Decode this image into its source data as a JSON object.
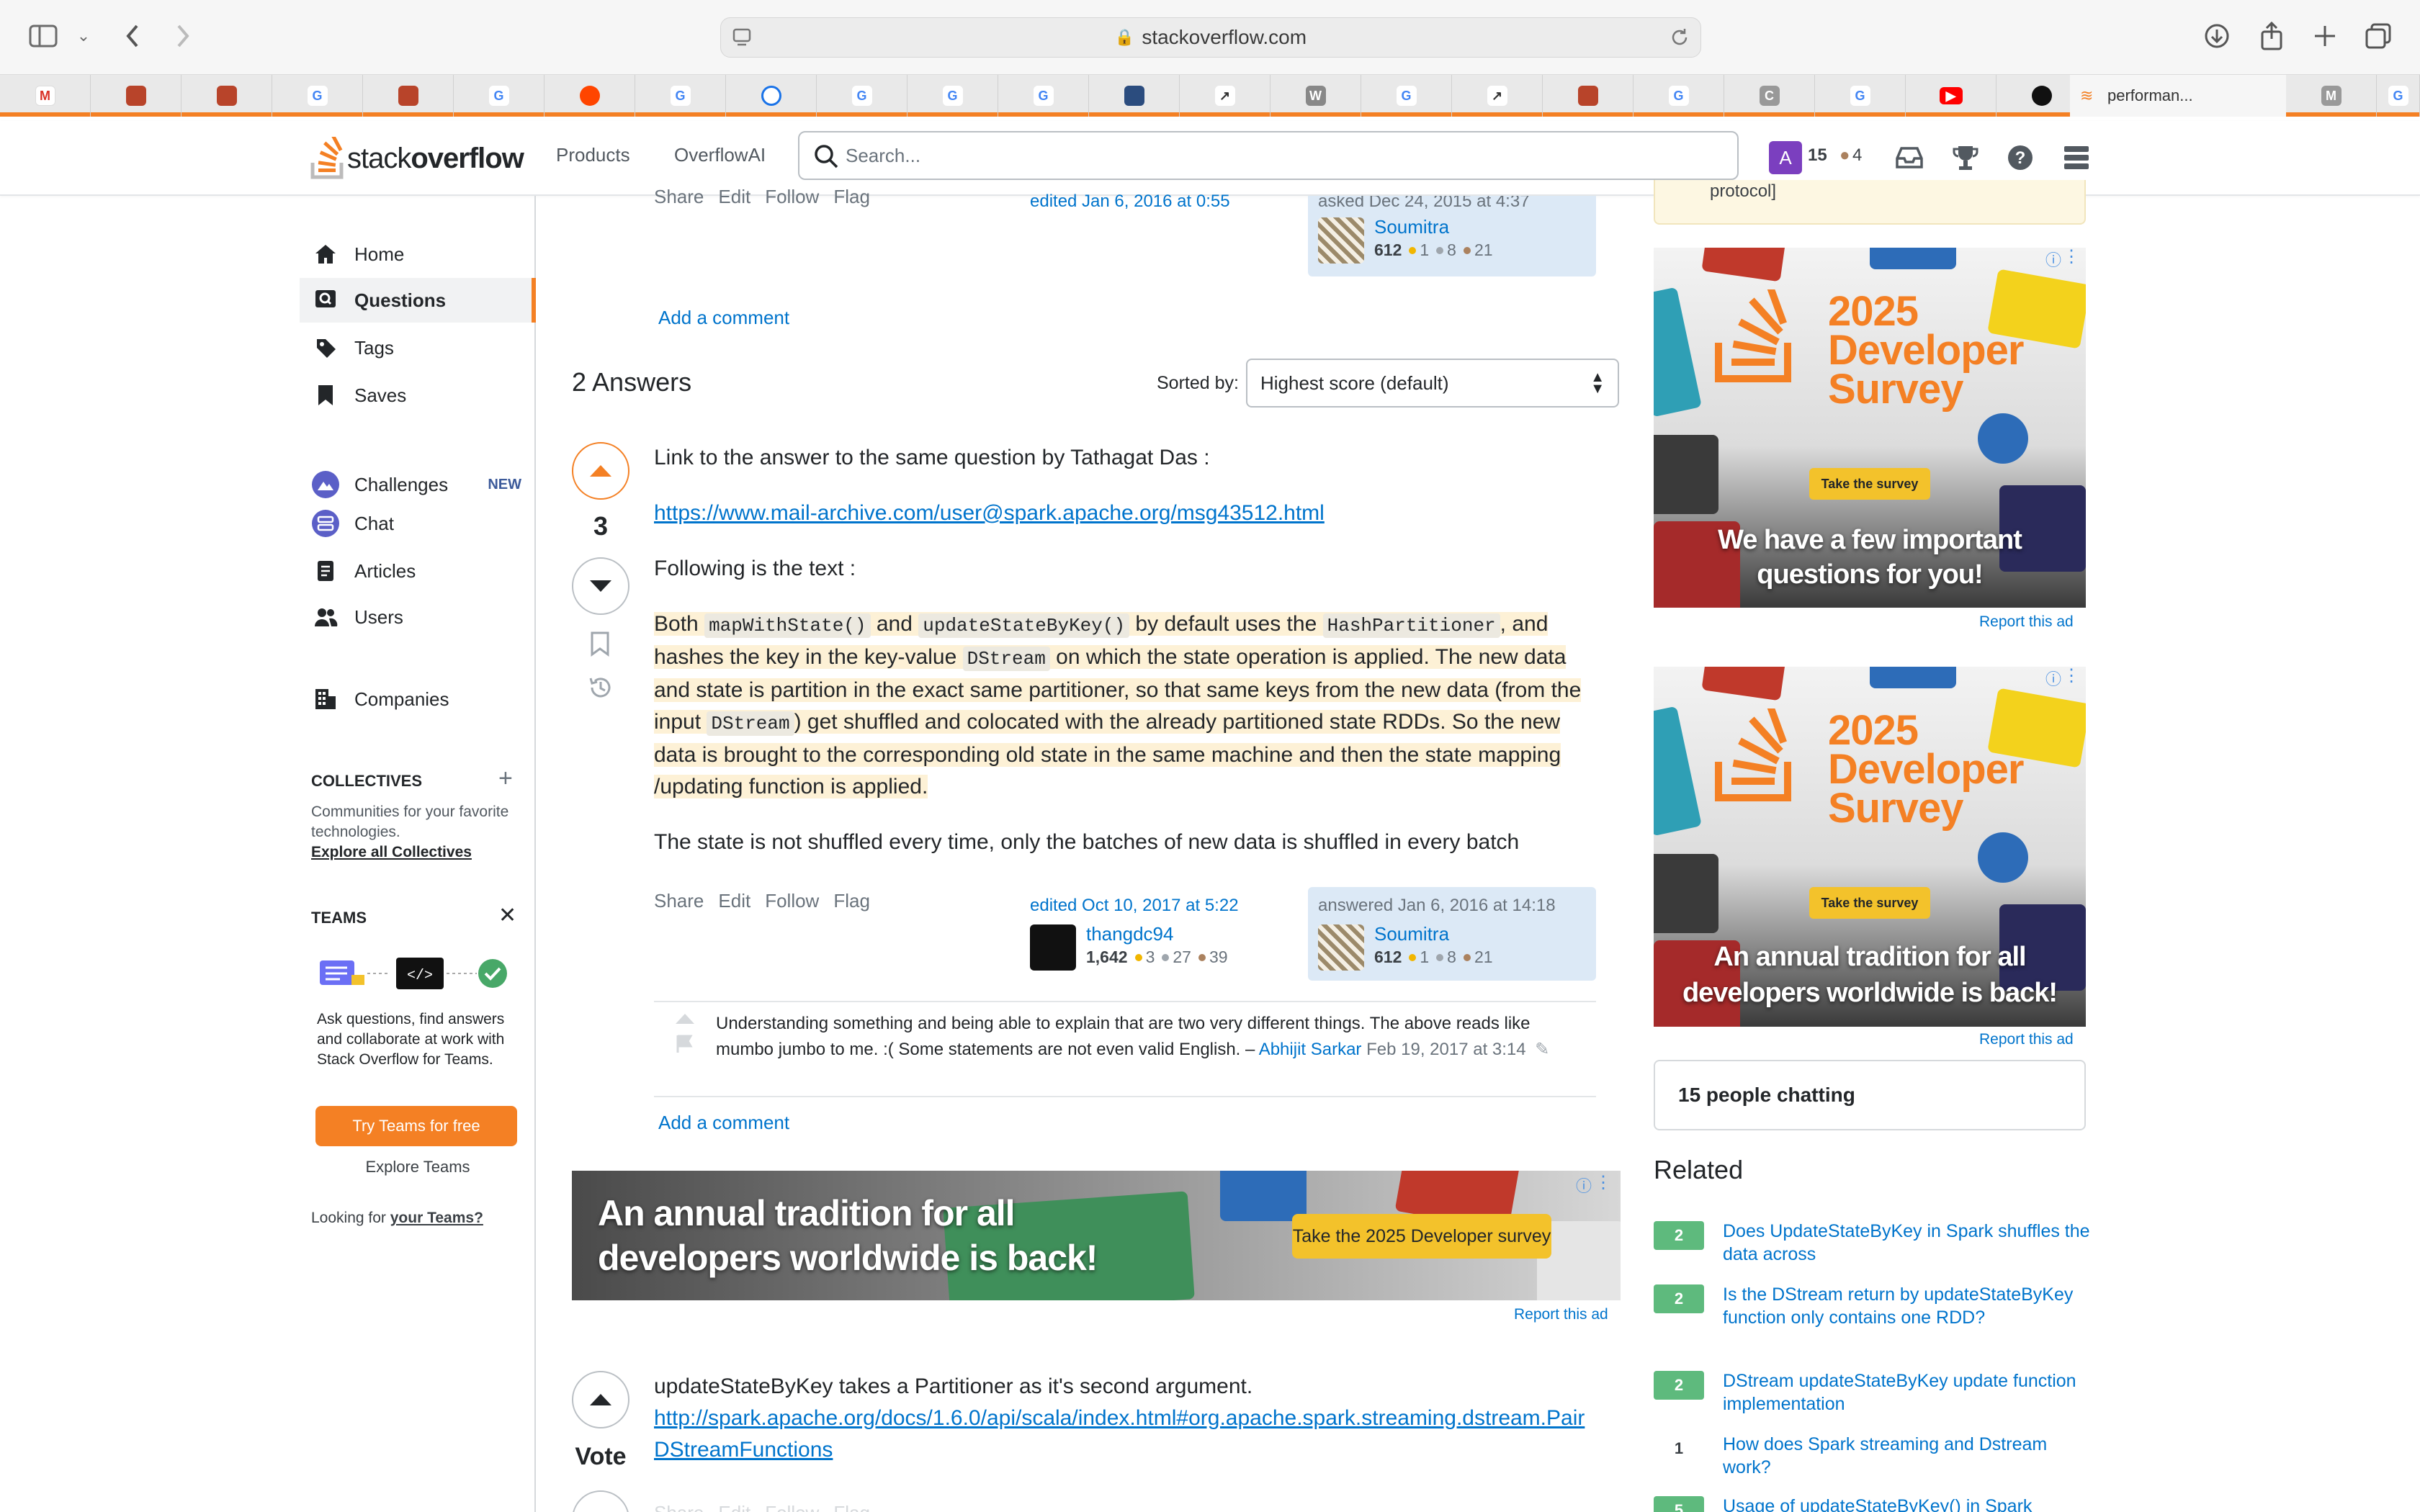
{
  "browser": {
    "url": "stackoverflow.com",
    "active_tab_label": "performan..."
  },
  "header": {
    "logo_light": "stack",
    "logo_bold": "overflow",
    "nav_products": "Products",
    "nav_overflowai": "OverflowAI",
    "search_placeholder": "Search...",
    "avatar_letter": "A",
    "reputation": "15",
    "bronze_count": "4"
  },
  "sidebar": {
    "items": [
      {
        "label": "Home"
      },
      {
        "label": "Questions"
      },
      {
        "label": "Tags"
      },
      {
        "label": "Saves"
      },
      {
        "label": "Challenges",
        "badge": "NEW"
      },
      {
        "label": "Chat"
      },
      {
        "label": "Articles"
      },
      {
        "label": "Users"
      },
      {
        "label": "Companies"
      }
    ],
    "collectives_title": "COLLECTIVES",
    "collectives_desc": "Communities for your favorite technologies.",
    "collectives_link": "Explore all Collectives",
    "teams_title": "TEAMS",
    "teams_desc": "Ask questions, find answers and collaborate at work with Stack Overflow for Teams.",
    "teams_button": "Try Teams for free",
    "teams_explore": "Explore Teams",
    "looking_for": "Looking for ",
    "looking_for_link": "your Teams?"
  },
  "question_footer": {
    "menu": [
      "Share",
      "Edit",
      "Follow",
      "Flag"
    ],
    "edited": "edited Jan 6, 2016 at 0:55",
    "asked": "asked Dec 24, 2015 at 4:37",
    "user": "Soumitra",
    "rep": "612",
    "gold": "1",
    "silver": "8",
    "bronze": "21",
    "add_comment": "Add a comment"
  },
  "answers_header": {
    "title": "2 Answers",
    "sorted_by": "Sorted by:",
    "sort_value": "Highest score (default)"
  },
  "answer1": {
    "score": "3",
    "p1": "Link to the answer to the same question by Tathagat Das :",
    "link": "https://www.mail-archive.com/user@spark.apache.org/msg43512.html",
    "p2": "Following is the text :",
    "q_both": "Both ",
    "q_code1": "mapWithState()",
    "q_and": " and ",
    "q_code2": "updateStateByKey()",
    "q_mid1": " by default uses the ",
    "q_code3": "HashPartitioner",
    "q_mid2": ", and hashes the key in the key-value ",
    "q_code4": "DStream",
    "q_mid3": " on which the state operation is applied. The new data and state is partition in the exact same partitioner, so that same keys from the new data (from the input ",
    "q_code5": "DStream",
    "q_end": ") get shuffled and colocated with the already partitioned state RDDs. So the new data is brought to the corresponding old state in the same machine and then the state mapping /updating function is applied.",
    "p4": "The state is not shuffled every time, only the batches of new data is shuffled in every batch",
    "menu": [
      "Share",
      "Edit",
      "Follow",
      "Flag"
    ],
    "edited": "edited Oct 10, 2017 at 5:22",
    "editor": "thangdc94",
    "editor_rep": "1,642",
    "editor_gold": "3",
    "editor_silver": "27",
    "editor_bronze": "39",
    "answered": "answered Jan 6, 2016 at 14:18",
    "author": "Soumitra",
    "author_rep": "612",
    "author_gold": "1",
    "author_silver": "8",
    "author_bronze": "21",
    "comment_text": "Understanding something and being able to explain that are two very different things. The above reads like mumbo jumbo to me. :( Some statements are not even valid English. – ",
    "comment_user": "Abhijit Sarkar",
    "comment_date": " Feb 19, 2017 at 3:14",
    "add_comment": "Add a comment"
  },
  "inline_ad": {
    "caption_line1": "An annual tradition for all",
    "caption_line2": "developers worldwide is back!",
    "cta": "Take the 2025 Developer survey",
    "report": "Report this ad"
  },
  "answer2": {
    "vote_label": "Vote",
    "text": "updateStateByKey takes a Partitioner as it's second argument.",
    "link": "http://spark.apache.org/docs/1.6.0/api/scala/index.html#org.apache.spark.streaming.dstream.PairDStreamFunctions"
  },
  "right": {
    "notice_tail": "protocol]",
    "ad1": {
      "title": [
        "2025",
        "Developer",
        "Survey"
      ],
      "cta": "Take the survey",
      "caption1": "We have a few important",
      "caption2": "questions for you!",
      "report": "Report this ad"
    },
    "ad2": {
      "title": [
        "2025",
        "Developer",
        "Survey"
      ],
      "cta": "Take the survey",
      "caption1": "An annual tradition for all",
      "caption2": "developers worldwide is back!",
      "report": "Report this ad"
    },
    "chat": "15 people chatting",
    "related_title": "Related",
    "related": [
      {
        "score": "2",
        "title": "Does UpdateStateByKey in Spark shuffles the data across"
      },
      {
        "score": "2",
        "title": "Is the DStream return by updateStateByKey function only contains one RDD?"
      },
      {
        "score": "2",
        "title": "DStream updateStateByKey update function implementation"
      },
      {
        "score": "1",
        "title": "How does Spark streaming and Dstream work?"
      },
      {
        "score": "5",
        "title": "Usage of updateStateByKey() in Spark"
      }
    ]
  },
  "colors": {
    "accent": "#f48024",
    "link": "#0074cc",
    "accepted_green": "#5eba7d",
    "highlight": "#fdf1d6"
  }
}
